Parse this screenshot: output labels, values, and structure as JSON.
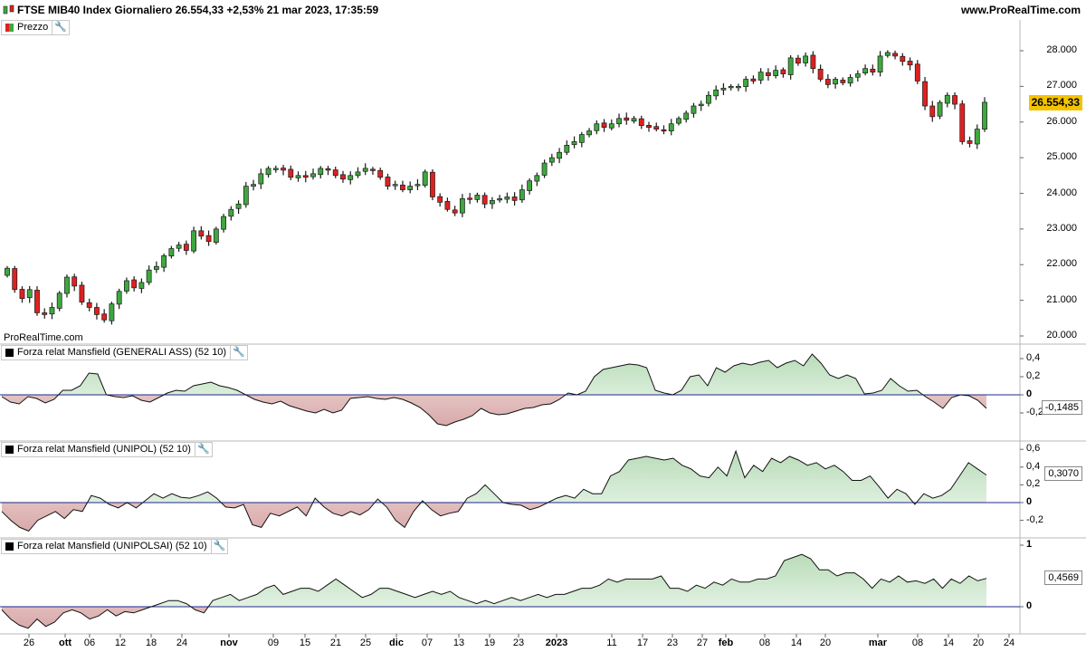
{
  "header": {
    "title": "FTSE MIB40 Index Giornaliero 26.554,33 +2,53% 21 mar 2023, 17:35:59",
    "site": "www.ProRealTime.com"
  },
  "watermark": "ProRealTime.com",
  "colors": {
    "up": "#3ea83e",
    "down": "#e02020",
    "baseline": "#1f2a8a",
    "pos_fill": "#d9eed9",
    "neg_fill": "#e8c4c4",
    "price_tag": "#f3c300"
  },
  "panels": {
    "price": {
      "legend": "Prezzo",
      "last_value": "26.554,33",
      "y_ticks": [
        "28.000",
        "27.000",
        "26.000",
        "25.000",
        "24.000",
        "23.000",
        "22.000",
        "21.000",
        "20.000"
      ]
    },
    "ind1": {
      "legend": "Forza relat Mansfield (GENERALI ASS) (52 10)",
      "last_value": "-0,1485",
      "y_ticks": [
        "0,4",
        "0,2",
        "0",
        "-0,2"
      ]
    },
    "ind2": {
      "legend": "Forza relat Mansfield (UNIPOL) (52 10)",
      "last_value": "0,3070",
      "y_ticks": [
        "0,6",
        "0,4",
        "0,2",
        "0",
        "-0,2"
      ]
    },
    "ind3": {
      "legend": "Forza relat Mansfield (UNIPOLSAI) (52 10)",
      "last_value": "0,4569",
      "y_ticks": [
        "1",
        "0"
      ]
    }
  },
  "x_axis": [
    "26",
    "ott",
    "06",
    "12",
    "18",
    "24",
    "nov",
    "09",
    "15",
    "21",
    "25",
    "dic",
    "07",
    "13",
    "19",
    "23",
    "2023",
    "11",
    "17",
    "23",
    "27",
    "feb",
    "08",
    "14",
    "20",
    "mar",
    "08",
    "14",
    "20",
    "24"
  ],
  "x_axis_bold": [
    "ott",
    "nov",
    "dic",
    "2023",
    "feb",
    "mar"
  ],
  "chart_data": [
    {
      "type": "candlestick",
      "title": "FTSE MIB40 Index Giornaliero",
      "series": [
        {
          "name": "Prezzo",
          "close": [
            21900,
            21300,
            21050,
            21300,
            20650,
            20600,
            20800,
            21200,
            21650,
            21400,
            20950,
            20800,
            20600,
            20450,
            20900,
            21250,
            21550,
            21350,
            21500,
            21850,
            21950,
            22250,
            22450,
            22550,
            22400,
            22950,
            22800,
            22650,
            23000,
            23350,
            23550,
            23700,
            24200,
            24250,
            24550,
            24700,
            24700,
            24650,
            24450,
            24500,
            24450,
            24550,
            24700,
            24650,
            24500,
            24400,
            24500,
            24600,
            24700,
            24650,
            24450,
            24200,
            24250,
            24100,
            24200,
            24250,
            24600,
            23900,
            23750,
            23550,
            23450,
            23850,
            23850,
            23950,
            23700,
            23800,
            23850,
            23900,
            23800,
            24100,
            24350,
            24500,
            24850,
            25000,
            25150,
            25350,
            25450,
            25650,
            25750,
            25950,
            25850,
            25950,
            26100,
            26050,
            26100,
            25900,
            25850,
            25800,
            25750,
            25950,
            26100,
            26250,
            26450,
            26500,
            26750,
            26900,
            26950,
            27000,
            27000,
            27200,
            27150,
            27400,
            27300,
            27450,
            27350,
            27800,
            27650,
            27850,
            27500,
            27200,
            27050,
            27200,
            27100,
            27250,
            27350,
            27500,
            27400,
            27850,
            27950,
            27850,
            27700,
            27600,
            27150,
            26450,
            26150,
            26550,
            26750,
            26500,
            25450,
            25400,
            25800,
            26554
          ]
        }
      ]
    },
    {
      "type": "area",
      "title": "Forza relat Mansfield (GENERALI ASS) (52 10)",
      "series": [
        {
          "name": "Forza relat Mansfield (GENERALI ASS) (52 10)",
          "values": [
            -0.02,
            -0.08,
            -0.1,
            -0.02,
            -0.04,
            -0.09,
            -0.05,
            0.05,
            0.05,
            0.1,
            0.24,
            0.23,
            0.0,
            -0.02,
            -0.03,
            -0.01,
            -0.06,
            -0.08,
            -0.03,
            0.02,
            0.05,
            0.04,
            0.1,
            0.12,
            0.14,
            0.1,
            0.08,
            0.05,
            0.0,
            -0.05,
            -0.08,
            -0.1,
            -0.07,
            -0.12,
            -0.15,
            -0.18,
            -0.2,
            -0.16,
            -0.2,
            -0.17,
            -0.04,
            -0.03,
            -0.02,
            -0.04,
            -0.05,
            -0.03,
            -0.05,
            -0.09,
            -0.14,
            -0.22,
            -0.32,
            -0.34,
            -0.3,
            -0.27,
            -0.23,
            -0.15,
            -0.2,
            -0.22,
            -0.21,
            -0.18,
            -0.15,
            -0.14,
            -0.11,
            -0.1,
            -0.05,
            0.02,
            0.0,
            0.04,
            0.2,
            0.28,
            0.3,
            0.32,
            0.34,
            0.33,
            0.3,
            0.05,
            0.02,
            0.0,
            0.05,
            0.2,
            0.22,
            0.1,
            0.3,
            0.25,
            0.32,
            0.35,
            0.33,
            0.36,
            0.38,
            0.3,
            0.35,
            0.38,
            0.32,
            0.45,
            0.35,
            0.22,
            0.18,
            0.22,
            0.18,
            0.01,
            0.02,
            0.05,
            0.18,
            0.1,
            0.04,
            0.05,
            -0.02,
            -0.08,
            -0.15,
            -0.03,
            0.0,
            -0.01,
            -0.06,
            -0.15
          ]
        }
      ]
    },
    {
      "type": "area",
      "title": "Forza relat Mansfield (UNIPOL) (52 10)",
      "series": [
        {
          "name": "Forza relat Mansfield (UNIPOL) (52 10)",
          "values": [
            -0.1,
            -0.2,
            -0.28,
            -0.32,
            -0.2,
            -0.15,
            -0.1,
            -0.18,
            -0.08,
            -0.1,
            0.08,
            0.05,
            -0.02,
            -0.06,
            0.0,
            -0.06,
            0.02,
            0.1,
            0.05,
            0.1,
            0.06,
            0.05,
            0.08,
            0.12,
            0.05,
            -0.05,
            -0.06,
            -0.02,
            -0.25,
            -0.28,
            -0.12,
            -0.15,
            -0.1,
            -0.05,
            -0.15,
            0.05,
            -0.05,
            -0.12,
            -0.15,
            -0.1,
            -0.14,
            -0.08,
            0.04,
            -0.05,
            -0.2,
            -0.28,
            -0.1,
            0.02,
            -0.08,
            -0.15,
            -0.12,
            -0.1,
            0.05,
            0.1,
            0.2,
            0.1,
            0.0,
            -0.02,
            -0.03,
            -0.08,
            -0.05,
            0.0,
            0.05,
            0.08,
            0.05,
            0.15,
            0.1,
            0.1,
            0.3,
            0.35,
            0.48,
            0.5,
            0.52,
            0.5,
            0.48,
            0.5,
            0.42,
            0.38,
            0.3,
            0.28,
            0.4,
            0.3,
            0.58,
            0.28,
            0.42,
            0.35,
            0.5,
            0.45,
            0.52,
            0.48,
            0.42,
            0.45,
            0.38,
            0.42,
            0.35,
            0.25,
            0.25,
            0.3,
            0.18,
            0.05,
            0.15,
            0.1,
            -0.02,
            0.1,
            0.05,
            0.08,
            0.15,
            0.3,
            0.45,
            0.38,
            0.31
          ]
        }
      ]
    },
    {
      "type": "area",
      "title": "Forza relat Mansfield (UNIPOLSAI) (52 10)",
      "series": [
        {
          "name": "Forza relat Mansfield (UNIPOLSAI) (52 10)",
          "values": [
            -0.05,
            -0.2,
            -0.3,
            -0.35,
            -0.2,
            -0.32,
            -0.25,
            -0.1,
            -0.05,
            -0.1,
            -0.2,
            -0.15,
            -0.05,
            -0.15,
            -0.08,
            -0.1,
            -0.05,
            0.0,
            0.05,
            0.1,
            0.1,
            0.05,
            -0.05,
            -0.1,
            0.1,
            0.15,
            0.2,
            0.1,
            0.15,
            0.2,
            0.3,
            0.35,
            0.2,
            0.25,
            0.3,
            0.3,
            0.25,
            0.35,
            0.45,
            0.35,
            0.25,
            0.15,
            0.2,
            0.3,
            0.3,
            0.25,
            0.2,
            0.15,
            0.2,
            0.25,
            0.2,
            0.25,
            0.15,
            0.1,
            0.05,
            0.1,
            0.05,
            0.1,
            0.15,
            0.1,
            0.15,
            0.2,
            0.15,
            0.2,
            0.2,
            0.25,
            0.3,
            0.3,
            0.35,
            0.45,
            0.4,
            0.45,
            0.45,
            0.45,
            0.45,
            0.5,
            0.3,
            0.3,
            0.25,
            0.35,
            0.3,
            0.4,
            0.35,
            0.45,
            0.4,
            0.4,
            0.45,
            0.45,
            0.5,
            0.75,
            0.8,
            0.85,
            0.78,
            0.6,
            0.6,
            0.5,
            0.55,
            0.55,
            0.45,
            0.3,
            0.45,
            0.4,
            0.5,
            0.4,
            0.42,
            0.38,
            0.45,
            0.3,
            0.45,
            0.38,
            0.5,
            0.42,
            0.46
          ]
        }
      ]
    }
  ]
}
